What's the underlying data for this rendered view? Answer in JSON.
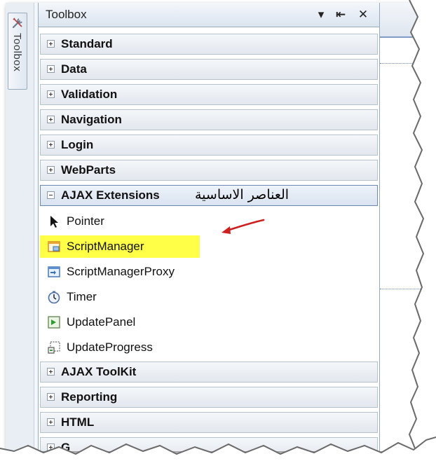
{
  "dock": {
    "tab_label": "Toolbox",
    "icon": "tools-icon"
  },
  "toolbox": {
    "title": "Toolbox",
    "header_buttons": {
      "dropdown_icon": "dropdown-arrow-icon",
      "pin_icon": "auto-hide-pin-icon",
      "close_icon": "close-icon",
      "dropdown_glyph": "▾",
      "pin_glyph": "⇤",
      "close_glyph": "✕"
    },
    "groups_top": [
      {
        "label": "Standard",
        "expanded": false
      },
      {
        "label": "Data",
        "expanded": false
      },
      {
        "label": "Validation",
        "expanded": false
      },
      {
        "label": "Navigation",
        "expanded": false
      },
      {
        "label": "Login",
        "expanded": false
      },
      {
        "label": "WebParts",
        "expanded": false
      }
    ],
    "open_group": {
      "label": "AJAX Extensions",
      "expanded": true,
      "annotation": "العناصر الاساسية"
    },
    "items": [
      {
        "label": "Pointer",
        "icon": "pointer-arrow-icon"
      },
      {
        "label": "ScriptManager",
        "icon": "script-manager-icon",
        "highlighted": true
      },
      {
        "label": "ScriptManagerProxy",
        "icon": "script-manager-proxy-icon"
      },
      {
        "label": "Timer",
        "icon": "timer-icon"
      },
      {
        "label": "UpdatePanel",
        "icon": "update-panel-icon"
      },
      {
        "label": "UpdateProgress",
        "icon": "update-progress-icon"
      }
    ],
    "groups_bottom": [
      {
        "label": "AJAX ToolKit",
        "expanded": false
      },
      {
        "label": "Reporting",
        "expanded": false
      },
      {
        "label": "HTML",
        "expanded": false
      },
      {
        "label": "G",
        "expanded": false
      }
    ]
  },
  "colors": {
    "highlight": "#ffff47",
    "annotation_arrow": "#cc1f1f",
    "accent": "#7f9cc4"
  }
}
